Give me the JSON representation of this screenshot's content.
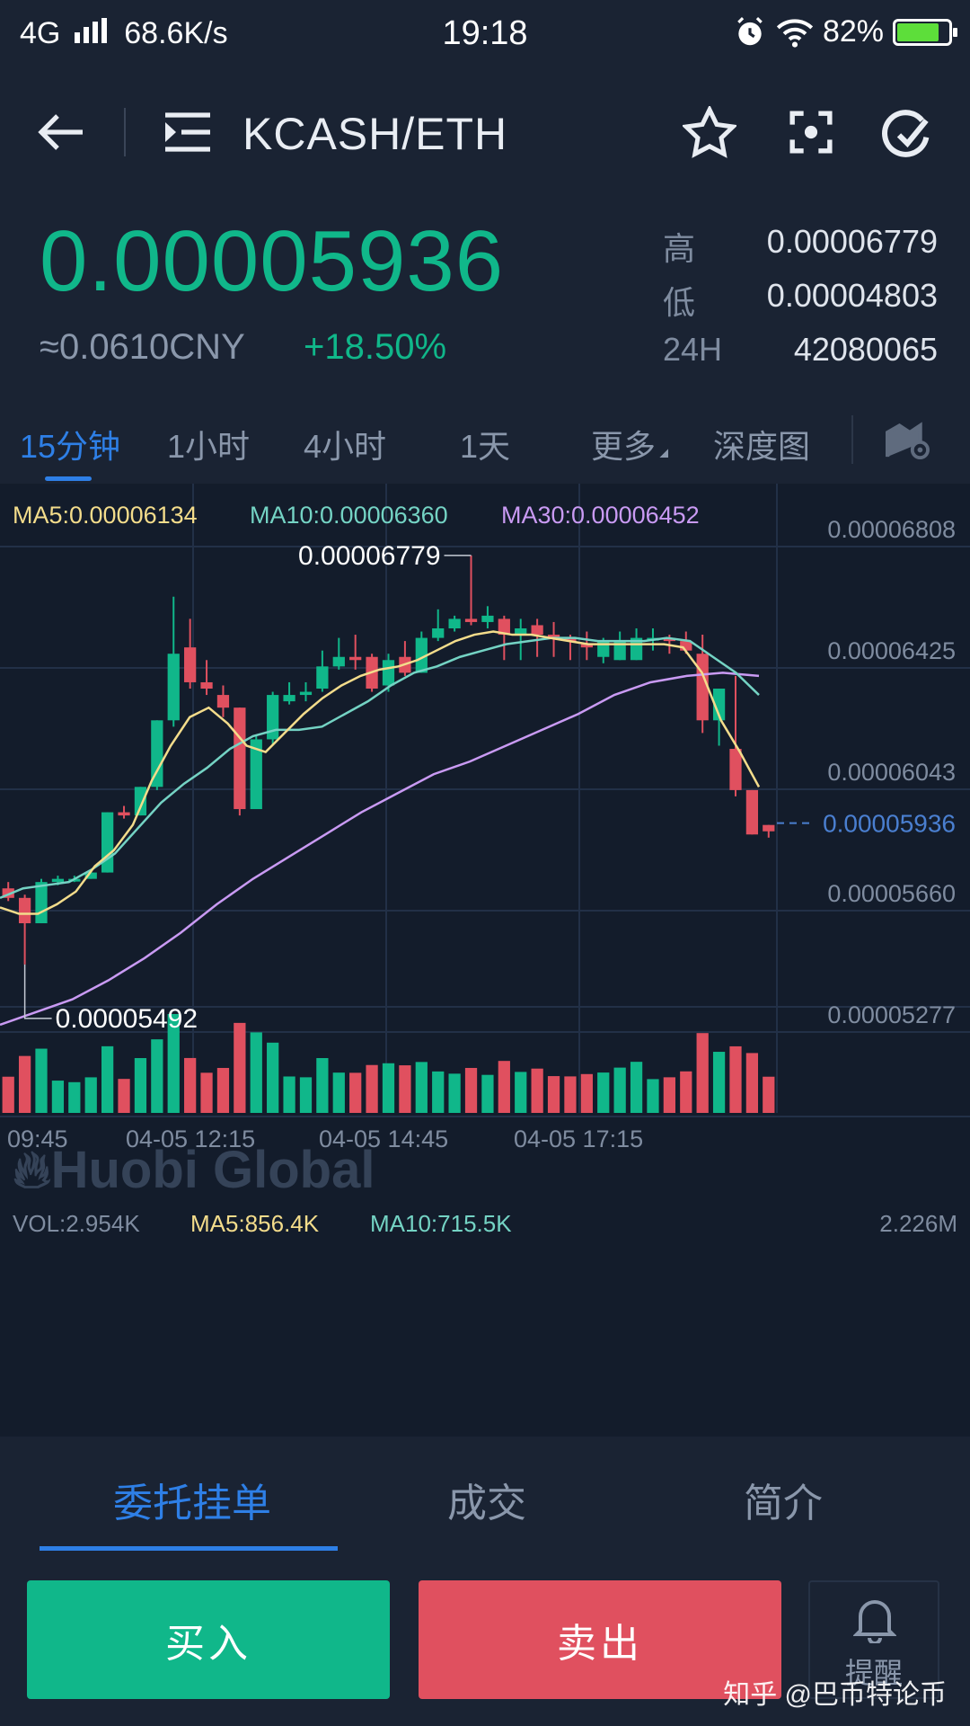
{
  "status_bar": {
    "network": "4G",
    "speed": "68.6K/s",
    "time": "19:18",
    "battery": "82%",
    "battery_level": 0.82
  },
  "header": {
    "pair": "KCASH/ETH",
    "icons": [
      "back-arrow-icon",
      "menu-list-icon",
      "star-icon",
      "scan-icon",
      "refresh-icon"
    ]
  },
  "ticker": {
    "price": "0.00005936",
    "cny": "≈0.0610CNY",
    "change": "+18.50%",
    "high_label": "高",
    "high": "0.00006779",
    "low_label": "低",
    "low": "0.00004803",
    "vol_label": "24H",
    "vol": "42080065"
  },
  "intervals": [
    "15分钟",
    "1小时",
    "4小时",
    "1天",
    "更多",
    "深度图"
  ],
  "active_interval": "15分钟",
  "ma_legend": {
    "ma5": "MA5:0.00006134",
    "ma10": "MA10:0.00006360",
    "ma30": "MA30:0.00006452"
  },
  "vol_legend": {
    "vol": "VOL:2.954K",
    "ma5": "MA5:856.4K",
    "ma10": "MA10:715.5K",
    "max": "2.226M"
  },
  "watermark_logo": "Huobi Global",
  "annotations": {
    "high": "0.00006779",
    "low": "0.00005492"
  },
  "current_price_label": "0.00005936",
  "colors": {
    "up": "#10b78a",
    "down": "#e0505f",
    "ma5": "#f3dc8b",
    "ma10": "#74d3c4",
    "ma30": "#c99af3",
    "accent": "#2e7fe6"
  },
  "chart_data": {
    "type": "candlestick",
    "y_ticks": [
      "0.00006808",
      "0.00006425",
      "0.00006043",
      "0.00005660",
      "0.00005277"
    ],
    "ylim": [
      5.277e-05,
      6.808e-05
    ],
    "x_ticks": [
      "09:45",
      "04-05 12:15",
      "04-05 14:45",
      "04-05 17:15"
    ],
    "candles": [
      [
        5.73e-05,
        5.7e-05,
        5.75e-05,
        5.69e-05
      ],
      [
        5.7e-05,
        5.62e-05,
        5.71e-05,
        5.49e-05
      ],
      [
        5.62e-05,
        5.75e-05,
        5.76e-05,
        5.62e-05
      ],
      [
        5.75e-05,
        5.76e-05,
        5.77e-05,
        5.74e-05
      ],
      [
        5.76e-05,
        5.76e-05,
        5.77e-05,
        5.75e-05
      ],
      [
        5.76e-05,
        5.78e-05,
        5.79e-05,
        5.76e-05
      ],
      [
        5.78e-05,
        5.97e-05,
        5.97e-05,
        5.78e-05
      ],
      [
        5.97e-05,
        5.96e-05,
        5.99e-05,
        5.95e-05
      ],
      [
        5.96e-05,
        6.05e-05,
        6.05e-05,
        5.96e-05
      ],
      [
        6.05e-05,
        6.26e-05,
        6.26e-05,
        6.04e-05
      ],
      [
        6.26e-05,
        6.47e-05,
        6.65e-05,
        6.24e-05
      ],
      [
        6.49e-05,
        6.38e-05,
        6.58e-05,
        6.36e-05
      ],
      [
        6.38e-05,
        6.36e-05,
        6.45e-05,
        6.34e-05
      ],
      [
        6.34e-05,
        6.3e-05,
        6.37e-05,
        6.27e-05
      ],
      [
        6.3e-05,
        5.98e-05,
        6.3e-05,
        5.96e-05
      ],
      [
        5.98e-05,
        6.2e-05,
        6.21e-05,
        5.98e-05
      ],
      [
        6.2e-05,
        6.34e-05,
        6.35e-05,
        6.18e-05
      ],
      [
        6.32e-05,
        6.34e-05,
        6.38e-05,
        6.31e-05
      ],
      [
        6.34e-05,
        6.35e-05,
        6.38e-05,
        6.32e-05
      ],
      [
        6.36e-05,
        6.43e-05,
        6.48e-05,
        6.35e-05
      ],
      [
        6.43e-05,
        6.46e-05,
        6.52e-05,
        6.42e-05
      ],
      [
        6.46e-05,
        6.45e-05,
        6.53e-05,
        6.42e-05
      ],
      [
        6.46e-05,
        6.36e-05,
        6.47e-05,
        6.35e-05
      ],
      [
        6.37e-05,
        6.45e-05,
        6.47e-05,
        6.35e-05
      ],
      [
        6.46e-05,
        6.41e-05,
        6.51e-05,
        6.4e-05
      ],
      [
        6.41e-05,
        6.52e-05,
        6.54e-05,
        6.41e-05
      ],
      [
        6.52e-05,
        6.55e-05,
        6.61e-05,
        6.51e-05
      ],
      [
        6.55e-05,
        6.58e-05,
        6.59e-05,
        6.54e-05
      ],
      [
        6.58e-05,
        6.57e-05,
        6.78e-05,
        6.56e-05
      ],
      [
        6.57e-05,
        6.59e-05,
        6.62e-05,
        6.55e-05
      ],
      [
        6.58e-05,
        6.53e-05,
        6.59e-05,
        6.45e-05
      ],
      [
        6.53e-05,
        6.55e-05,
        6.58e-05,
        6.45e-05
      ],
      [
        6.56e-05,
        6.53e-05,
        6.58e-05,
        6.46e-05
      ],
      [
        6.53e-05,
        6.52e-05,
        6.57e-05,
        6.46e-05
      ],
      [
        6.52e-05,
        6.51e-05,
        6.53e-05,
        6.45e-05
      ],
      [
        6.5e-05,
        6.49e-05,
        6.54e-05,
        6.45e-05
      ],
      [
        6.46e-05,
        6.51e-05,
        6.52e-05,
        6.44e-05
      ],
      [
        6.45e-05,
        6.51e-05,
        6.54e-05,
        6.45e-05
      ],
      [
        6.45e-05,
        6.52e-05,
        6.55e-05,
        6.45e-05
      ],
      [
        6.52e-05,
        6.52e-05,
        6.55e-05,
        6.48e-05
      ],
      [
        6.52e-05,
        6.51e-05,
        6.53e-05,
        6.47e-05
      ],
      [
        6.51e-05,
        6.48e-05,
        6.54e-05,
        6.47e-05
      ],
      [
        6.47e-05,
        6.26e-05,
        6.53e-05,
        6.22e-05
      ],
      [
        6.26e-05,
        6.36e-05,
        6.36e-05,
        6.18e-05
      ],
      [
        6.17e-05,
        6.04e-05,
        6.4e-05,
        6.02e-05
      ],
      [
        6.04e-05,
        5.9e-05,
        6.04e-05,
        5.9e-05
      ],
      [
        5.93e-05,
        5.91e-05,
        5.93e-05,
        5.89e-05
      ]
    ],
    "ma5": [
      5.67e-05,
      5.65e-05,
      5.65e-05,
      5.68e-05,
      5.72e-05,
      5.8e-05,
      5.85e-05,
      5.93e-05,
      6.07e-05,
      6.18e-05,
      6.27e-05,
      6.3e-05,
      6.25e-05,
      6.18e-05,
      6.16e-05,
      6.22e-05,
      6.28e-05,
      6.33e-05,
      6.37e-05,
      6.4e-05,
      6.42e-05,
      6.43e-05,
      6.45e-05,
      6.48e-05,
      6.51e-05,
      6.53e-05,
      6.54e-05,
      6.53e-05,
      6.53e-05,
      6.52e-05,
      6.51e-05,
      6.5e-05,
      6.5e-05,
      6.5e-05,
      6.5e-05,
      6.5e-05,
      6.49e-05,
      6.41e-05,
      6.26e-05,
      6.16e-05,
      6.05e-05
    ],
    "ma10": [
      5.7e-05,
      5.73e-05,
      5.74e-05,
      5.75e-05,
      5.79e-05,
      5.84e-05,
      5.92e-05,
      6e-05,
      6.06e-05,
      6.11e-05,
      6.17e-05,
      6.21e-05,
      6.23e-05,
      6.23e-05,
      6.24e-05,
      6.28e-05,
      6.32e-05,
      6.37e-05,
      6.41e-05,
      6.43e-05,
      6.46e-05,
      6.48e-05,
      6.5e-05,
      6.51e-05,
      6.52e-05,
      6.52e-05,
      6.51e-05,
      6.51e-05,
      6.51e-05,
      6.52e-05,
      6.51e-05,
      6.46e-05,
      6.41e-05,
      6.34e-05
    ],
    "ma30": [
      5.3e-05,
      5.34e-05,
      5.38e-05,
      5.44e-05,
      5.51e-05,
      5.59e-05,
      5.68e-05,
      5.76e-05,
      5.83e-05,
      5.9e-05,
      5.97e-05,
      6.03e-05,
      6.09e-05,
      6.13e-05,
      6.18e-05,
      6.23e-05,
      6.28e-05,
      6.34e-05,
      6.38e-05,
      6.4e-05,
      6.41e-05,
      6.4e-05
    ]
  },
  "bottom_tabs": [
    "委托挂单",
    "成交",
    "简介"
  ],
  "active_bottom_tab": "委托挂单",
  "actions": {
    "buy": "买入",
    "sell": "卖出",
    "alert": "提醒"
  },
  "footer_watermark": "知乎 @巴币特论币"
}
